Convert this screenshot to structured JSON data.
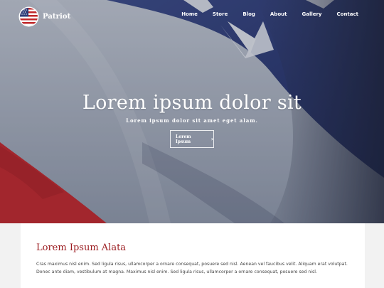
{
  "brand": {
    "name": "Patriot",
    "logo_icon": "us-flag-icon"
  },
  "nav": {
    "items": [
      "Home",
      "Store",
      "Blog",
      "About",
      "Gallery",
      "Contact"
    ]
  },
  "hero": {
    "title": "Lorem ipsum dolor sit",
    "subtitle": "Lorem ipsum dolor sit amet eget alam.",
    "button_label": "Lorem Ipsum",
    "button_icon": "chevron-right-icon"
  },
  "content": {
    "heading": "Lorem Ipsum Alata",
    "body": "Cras maximus nisl enim. Sed ligula risus, ullamcorper a ornare consequat, posuere sed nisl. Aenean vel faucibus velit. Aliquam erat volutpat. Donec ante diam, vestibulum at magna. Maximus nisl enim. Sed ligula risus, ullamcorper a ornare consequat, posuere sed nisl."
  },
  "colors": {
    "accent_red": "#9b1b1f",
    "flag_blue": "#2b3a78",
    "flag_red": "#c0282b"
  }
}
